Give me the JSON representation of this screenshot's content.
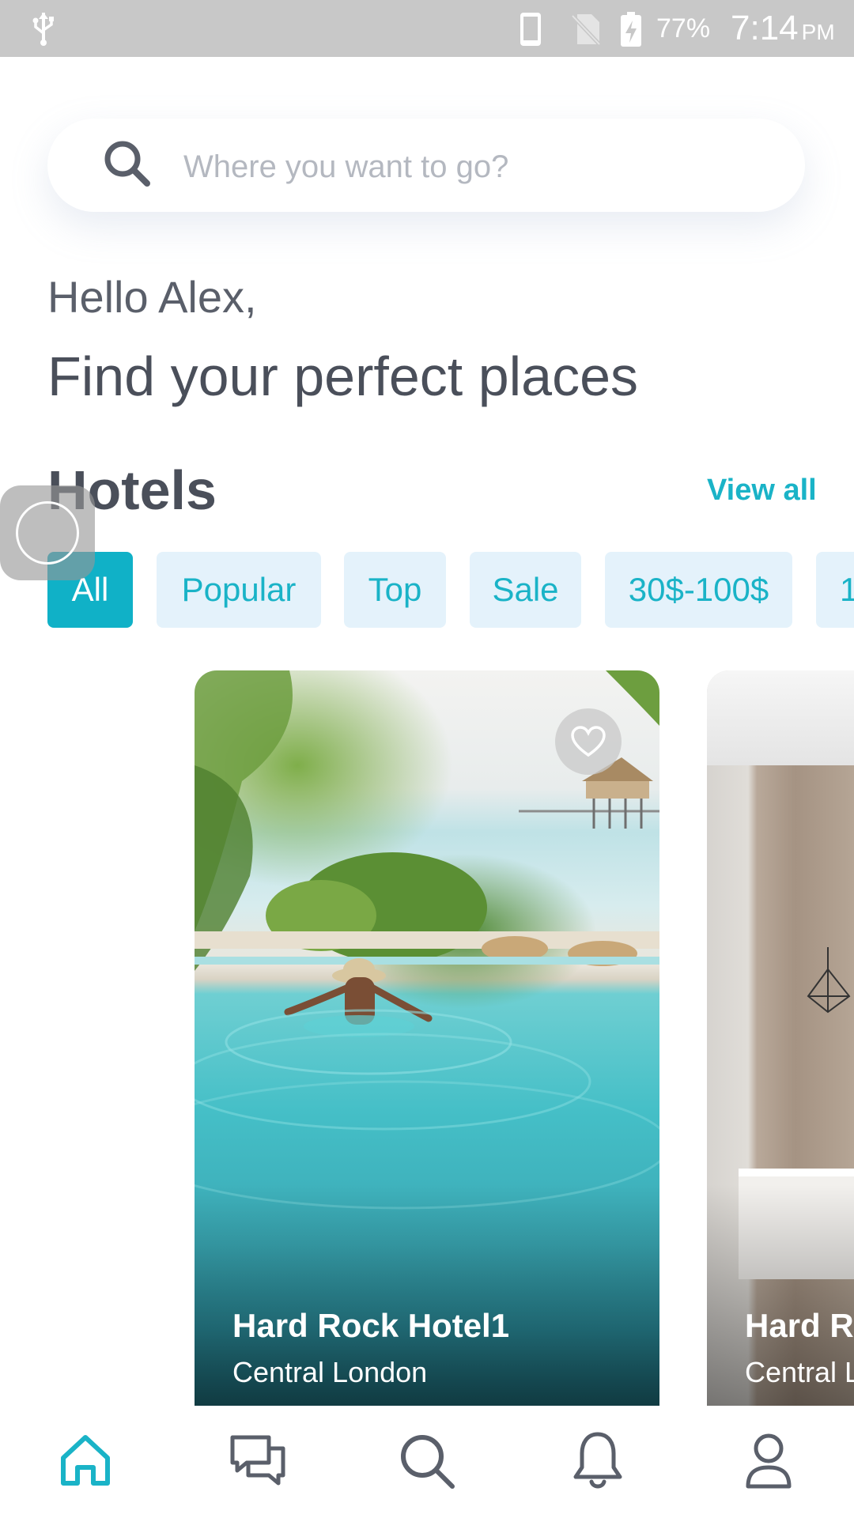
{
  "status_bar": {
    "battery": "77%",
    "time": "7:14",
    "ampm": "PM",
    "icons": [
      "usb-icon",
      "phone-icon",
      "no-sim-icon",
      "battery-charging-icon"
    ]
  },
  "search": {
    "placeholder": "Where you want to go?",
    "icon": "search-icon"
  },
  "greeting": {
    "hello": "Hello Alex,",
    "headline": "Find your perfect places"
  },
  "hotels": {
    "title": "Hotels",
    "view_all": "View all",
    "filters": [
      {
        "label": "All",
        "active": true
      },
      {
        "label": "Popular",
        "active": false
      },
      {
        "label": "Top",
        "active": false
      },
      {
        "label": "Sale",
        "active": false
      },
      {
        "label": "30$-100$",
        "active": false
      },
      {
        "label": "1",
        "active": false
      }
    ],
    "cards": [
      {
        "name": "Hard Rock Hotel1",
        "location": "Central London",
        "favorite_icon": "heart-icon"
      },
      {
        "name": "Hard R",
        "location": "Central L"
      }
    ]
  },
  "bottom_nav": {
    "items": [
      {
        "icon": "home-icon",
        "active": true
      },
      {
        "icon": "chat-icon",
        "active": false
      },
      {
        "icon": "search-icon",
        "active": false
      },
      {
        "icon": "bell-icon",
        "active": false
      },
      {
        "icon": "profile-icon",
        "active": false
      }
    ]
  },
  "colors": {
    "accent": "#1ab3c7",
    "chip_bg": "#e4f2fb",
    "text_dark": "#4a4f5a",
    "nav_inactive": "#5a5f6a",
    "status_bar": "#c8c8c8"
  }
}
